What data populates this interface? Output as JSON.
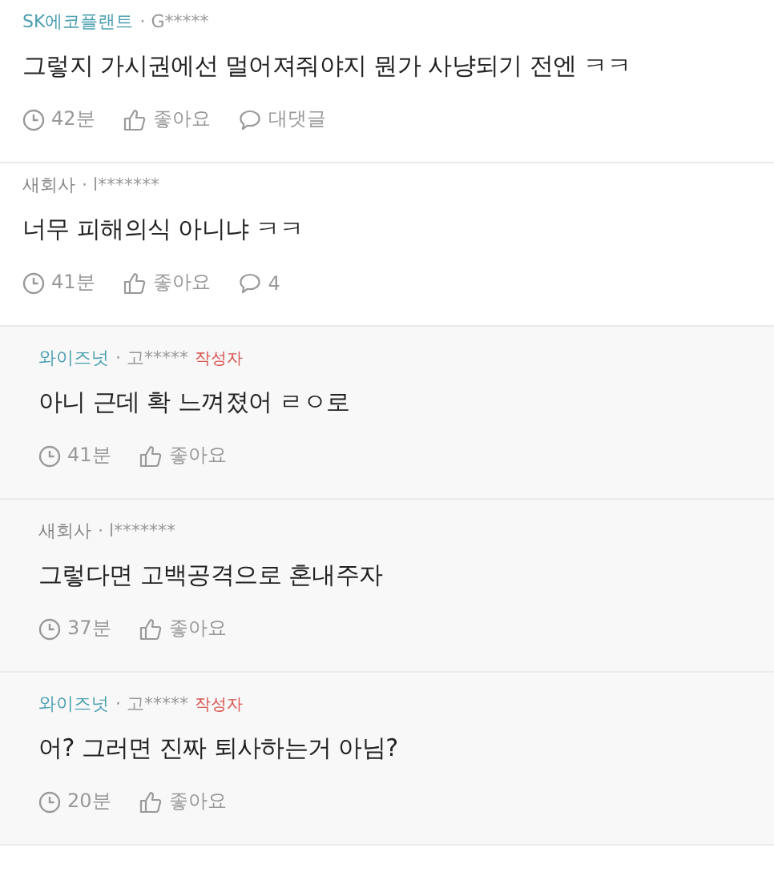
{
  "comments": [
    {
      "kind": "comment",
      "company": {
        "name": "SK에코플랜트",
        "color": "#4a9fb0"
      },
      "user": "· G*****",
      "body": "그렇지 가시권에선 멀어져줘야지 뭔가 사냥되기 전엔 ㅋㅋ",
      "time": "42분",
      "like": "좋아요",
      "reply": "대댓글"
    },
    {
      "kind": "comment",
      "company": {
        "name": "새회사",
        "color": "#888888"
      },
      "user": "· l*******",
      "body": "너무 피해의식 아니냐 ㅋㅋ",
      "time": "41분",
      "like": "좋아요",
      "reply": "4"
    },
    {
      "kind": "reply",
      "company": {
        "name": "와이즈넛",
        "color": "#4a9fb0"
      },
      "user": "· 고*****",
      "badge": "작성자",
      "body": "아니 근데 확 느껴졌어 ㄹㅇ로",
      "time": "41분",
      "like": "좋아요"
    },
    {
      "kind": "reply",
      "company": {
        "name": "새회사",
        "color": "#888888"
      },
      "user": "· l*******",
      "body": "그렇다면 고백공격으로 혼내주자",
      "time": "37분",
      "like": "좋아요"
    },
    {
      "kind": "reply",
      "company": {
        "name": "와이즈넛",
        "color": "#4a9fb0"
      },
      "user": "· 고*****",
      "badge": "작성자",
      "body": "어? 그러면 진짜 퇴사하는거 아님?",
      "time": "20분",
      "like": "좋아요"
    }
  ]
}
